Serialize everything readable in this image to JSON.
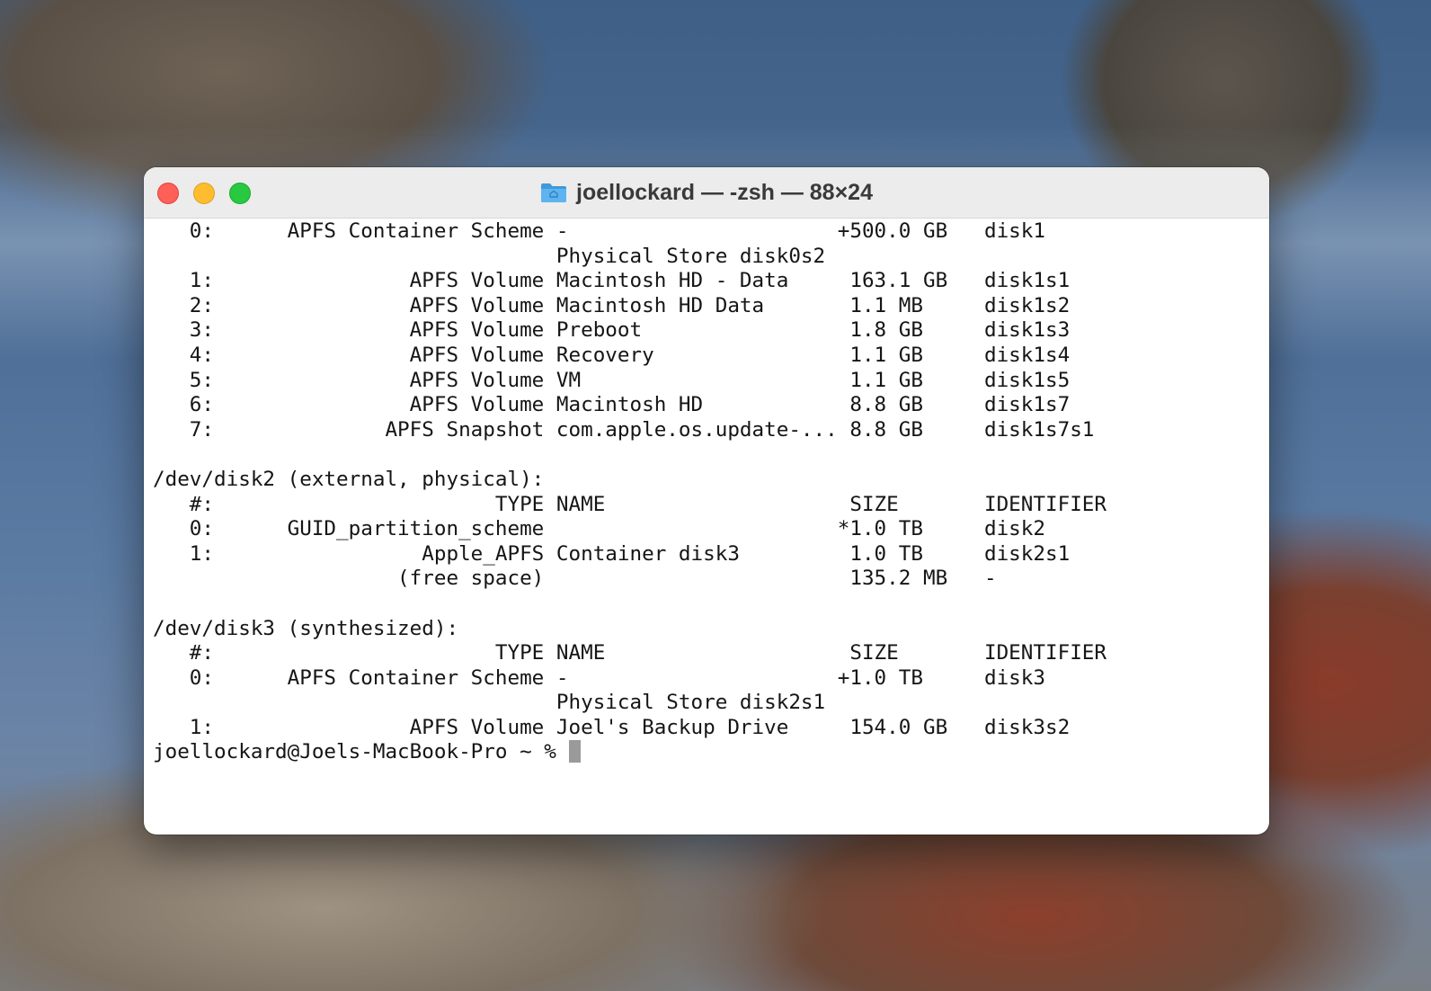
{
  "window": {
    "title": "joellockard — -zsh — 88×24",
    "title_icon": "folder-icon",
    "colors": {
      "close": "#fe5f57",
      "minimize": "#febc2e",
      "zoom": "#28c840"
    }
  },
  "terminal": {
    "lines": [
      "   0:      APFS Container Scheme -                      +500.0 GB   disk1",
      "                                 Physical Store disk0s2",
      "   1:                APFS Volume Macintosh HD - Data     163.1 GB   disk1s1",
      "   2:                APFS Volume Macintosh HD Data       1.1 MB     disk1s2",
      "   3:                APFS Volume Preboot                 1.8 GB     disk1s3",
      "   4:                APFS Volume Recovery                1.1 GB     disk1s4",
      "   5:                APFS Volume VM                      1.1 GB     disk1s5",
      "   6:                APFS Volume Macintosh HD            8.8 GB     disk1s7",
      "   7:              APFS Snapshot com.apple.os.update-... 8.8 GB     disk1s7s1",
      "",
      "/dev/disk2 (external, physical):",
      "   #:                       TYPE NAME                    SIZE       IDENTIFIER",
      "   0:      GUID_partition_scheme                        *1.0 TB     disk2",
      "   1:                 Apple_APFS Container disk3         1.0 TB     disk2s1",
      "                    (free space)                         135.2 MB   -",
      "",
      "/dev/disk3 (synthesized):",
      "   #:                       TYPE NAME                    SIZE       IDENTIFIER",
      "   0:      APFS Container Scheme -                      +1.0 TB     disk3",
      "                                 Physical Store disk2s1",
      "   1:                APFS Volume Joel's Backup Drive     154.0 GB   disk3s2"
    ],
    "prompt": "joellockard@Joels-MacBook-Pro ~ % "
  }
}
